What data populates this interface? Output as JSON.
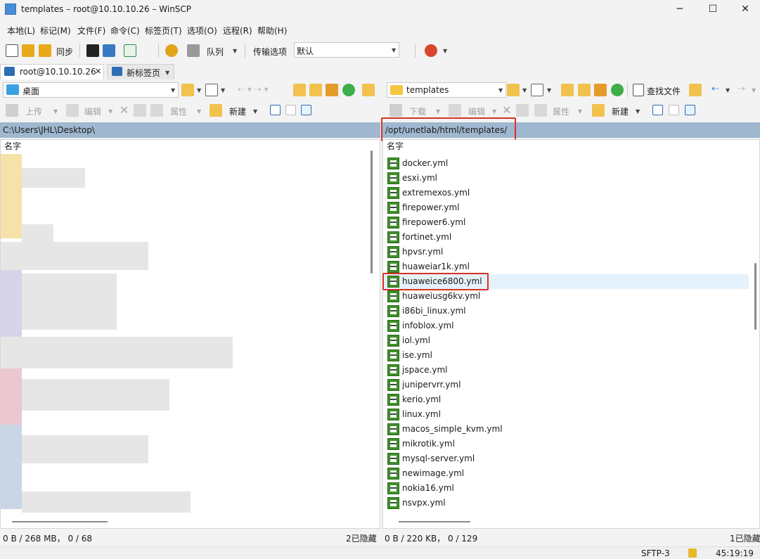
{
  "window": {
    "title": "templates – root@10.10.10.26 – WinSCP",
    "min": "─",
    "max": "☐",
    "close": "✕"
  },
  "menu": [
    "本地(L)",
    "标记(M)",
    "文件(F)",
    "命令(C)",
    "标签页(T)",
    "选项(O)",
    "远程(R)",
    "帮助(H)"
  ],
  "toolbar": {
    "sync_label": "同步",
    "queue_label": "队列",
    "transfer_label": "传输选项",
    "transfer_value": "默认"
  },
  "tabs": [
    {
      "label": "root@10.10.10.26",
      "close": "✕"
    },
    {
      "label": "新标签页"
    }
  ],
  "left": {
    "location": "桌面",
    "upload": "上传",
    "edit": "编辑",
    "props": "属性",
    "new": "新建",
    "path": "C:\\Users\\JHL\\Desktop\\",
    "col_name": "名字",
    "status_left": "0 B / 268 MB， 0 / 68",
    "status_right": "2已隐藏"
  },
  "right": {
    "location": "templates",
    "find": "查找文件",
    "download": "下载",
    "edit": "编辑",
    "props": "属性",
    "new": "新建",
    "path": "/opt/unetlab/html/templates/",
    "col_name": "名字",
    "files": [
      "docker.yml",
      "esxi.yml",
      "extremexos.yml",
      "firepower.yml",
      "firepower6.yml",
      "fortinet.yml",
      "hpvsr.yml",
      "huaweiar1k.yml",
      "huaweice6800.yml",
      "huaweiusg6kv.yml",
      "i86bi_linux.yml",
      "infoblox.yml",
      "iol.yml",
      "ise.yml",
      "jspace.yml",
      "junipervrr.yml",
      "kerio.yml",
      "linux.yml",
      "macos_simple_kvm.yml",
      "mikrotik.yml",
      "mysql-server.yml",
      "newimage.yml",
      "nokia16.yml",
      "nsvpx.yml"
    ],
    "selected": "huaweice6800.yml",
    "status_left": "0 B / 220 KB， 0 / 129",
    "status_right": "1已隐藏"
  },
  "bottom": {
    "protocol": "SFTP-3",
    "time": "45:19:19"
  },
  "colors": {
    "accent": "#d93025",
    "pathbar": "#9fb7cf",
    "selection": "#e5f1fb",
    "file_icon": "#3d8f28"
  }
}
